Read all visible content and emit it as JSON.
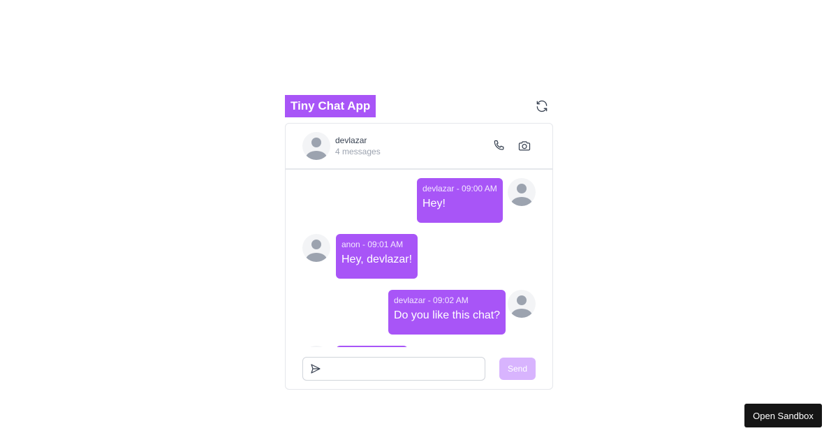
{
  "app": {
    "title": "Tiny Chat App",
    "refresh_icon": "refresh-icon"
  },
  "header": {
    "name": "devlazar",
    "count": "4 messages",
    "icons": [
      "phone-icon",
      "camera-icon"
    ]
  },
  "messages": [
    {
      "author": "devlazar",
      "meta": "devlazar - 09:00 AM",
      "text": "Hey!",
      "side": "right"
    },
    {
      "author": "anon",
      "meta": "anon - 09:01 AM",
      "text": "Hey, devlazar!",
      "side": "left"
    },
    {
      "author": "devlazar",
      "meta": "devlazar - 09:02 AM",
      "text": "Do you like this chat?",
      "side": "right"
    }
  ],
  "composer": {
    "value": "",
    "placeholder": "",
    "send_label": "Send"
  },
  "sandbox": {
    "label": "Open Sandbox"
  },
  "colors": {
    "accent": "#a855f7",
    "accent_light": "#d8b4fe",
    "avatar_bg": "#f3f4f6",
    "avatar_fg": "#9ca3af"
  }
}
